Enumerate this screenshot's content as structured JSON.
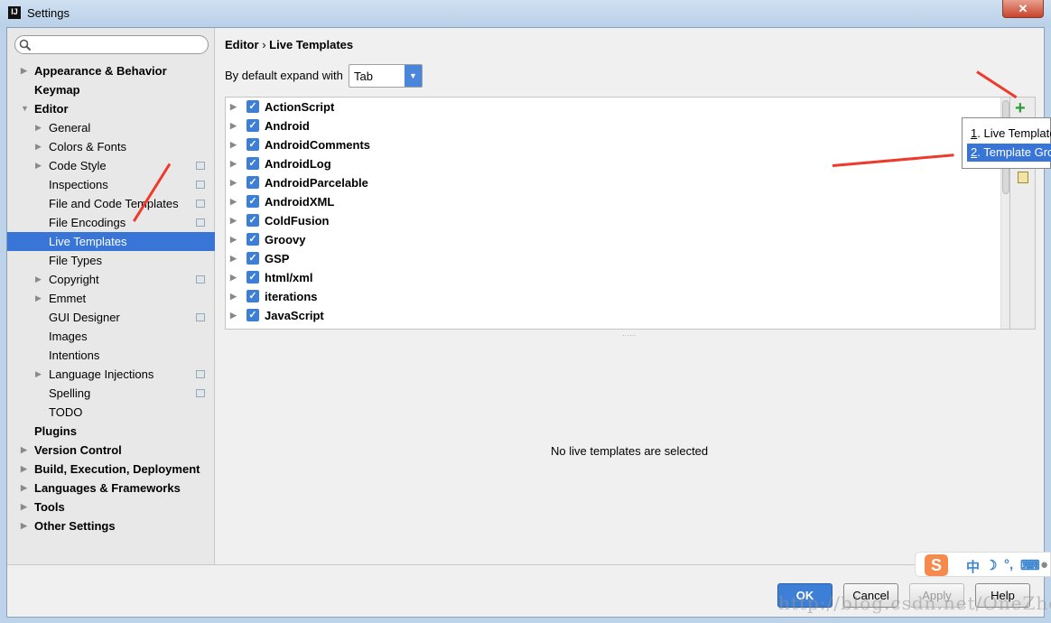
{
  "window": {
    "title": "Settings",
    "logo": "IJ",
    "close": "✕"
  },
  "sidebar": {
    "search_placeholder": "",
    "items": [
      {
        "label": "Appearance & Behavior",
        "level": 0,
        "bold": true,
        "arrow": "▶"
      },
      {
        "label": "Keymap",
        "level": 0,
        "bold": true,
        "arrow": ""
      },
      {
        "label": "Editor",
        "level": 0,
        "bold": true,
        "arrow": "▼"
      },
      {
        "label": "General",
        "level": 1,
        "arrow": "▶"
      },
      {
        "label": "Colors & Fonts",
        "level": 1,
        "arrow": "▶"
      },
      {
        "label": "Code Style",
        "level": 1,
        "arrow": "▶",
        "copy": true
      },
      {
        "label": "Inspections",
        "level": 1,
        "arrow": "",
        "copy": true
      },
      {
        "label": "File and Code Templates",
        "level": 1,
        "arrow": "",
        "copy": true
      },
      {
        "label": "File Encodings",
        "level": 1,
        "arrow": "",
        "copy": true
      },
      {
        "label": "Live Templates",
        "level": 1,
        "arrow": "",
        "selected": true
      },
      {
        "label": "File Types",
        "level": 1,
        "arrow": ""
      },
      {
        "label": "Copyright",
        "level": 1,
        "arrow": "▶",
        "copy": true
      },
      {
        "label": "Emmet",
        "level": 1,
        "arrow": "▶"
      },
      {
        "label": "GUI Designer",
        "level": 1,
        "arrow": "",
        "copy": true
      },
      {
        "label": "Images",
        "level": 1,
        "arrow": ""
      },
      {
        "label": "Intentions",
        "level": 1,
        "arrow": ""
      },
      {
        "label": "Language Injections",
        "level": 1,
        "arrow": "▶",
        "copy": true
      },
      {
        "label": "Spelling",
        "level": 1,
        "arrow": "",
        "copy": true
      },
      {
        "label": "TODO",
        "level": 1,
        "arrow": ""
      },
      {
        "label": "Plugins",
        "level": 0,
        "bold": true,
        "arrow": ""
      },
      {
        "label": "Version Control",
        "level": 0,
        "bold": true,
        "arrow": "▶"
      },
      {
        "label": "Build, Execution, Deployment",
        "level": 0,
        "bold": true,
        "arrow": "▶"
      },
      {
        "label": "Languages & Frameworks",
        "level": 0,
        "bold": true,
        "arrow": "▶"
      },
      {
        "label": "Tools",
        "level": 0,
        "bold": true,
        "arrow": "▶"
      },
      {
        "label": "Other Settings",
        "level": 0,
        "bold": true,
        "arrow": "▶"
      }
    ]
  },
  "main": {
    "breadcrumb": {
      "parent": "Editor",
      "sep": "›",
      "current": "Live Templates"
    },
    "expand_label": "By default expand with",
    "expand_value": "Tab",
    "groups": [
      "ActionScript",
      "Android",
      "AndroidComments",
      "AndroidLog",
      "AndroidParcelable",
      "AndroidXML",
      "ColdFusion",
      "Groovy",
      "GSP",
      "html/xml",
      "iterations",
      "JavaScript"
    ],
    "empty_message": "No live templates are selected",
    "add_icon": "+"
  },
  "popup": {
    "items": [
      {
        "num": "1",
        "label": ". Live Template"
      },
      {
        "num": "2",
        "label": ". Template Group..."
      }
    ]
  },
  "buttons": {
    "ok": "OK",
    "cancel": "Cancel",
    "apply": "Apply",
    "help": "Help"
  },
  "ime": {
    "logo": "S",
    "lang": "中"
  },
  "watermark": "http://blog.csdn.net/OneZhous",
  "colors": {
    "accent": "#3875d7",
    "arrow": "#ee3a2a",
    "add": "#2f9a3a"
  }
}
